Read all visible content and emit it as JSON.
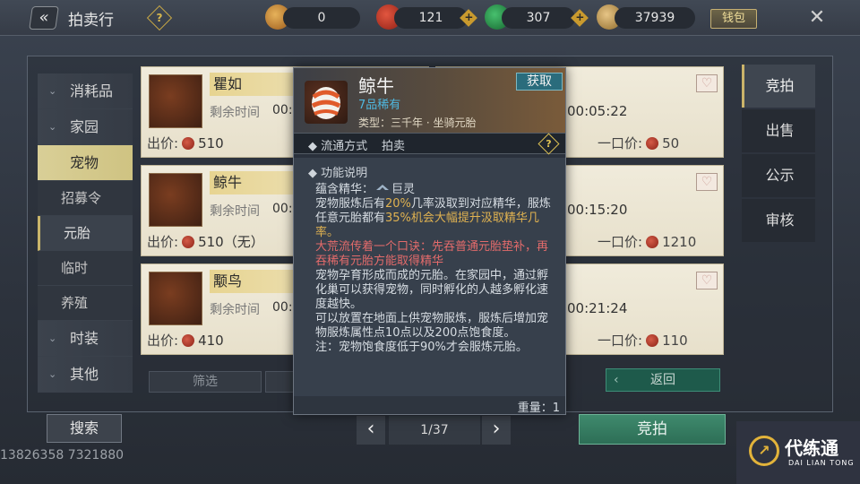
{
  "window": {
    "title": "拍卖行"
  },
  "currency": [
    {
      "name": "copper-coin",
      "value": "0",
      "color": "#d7943a"
    },
    {
      "name": "red-token",
      "value": "121",
      "color": "#c9412e"
    },
    {
      "name": "jade",
      "value": "307",
      "color": "#2f9a52"
    },
    {
      "name": "silver",
      "value": "37939",
      "color": "#c7a25b"
    }
  ],
  "top": {
    "wallet_label": "钱包",
    "help": "?"
  },
  "sidebar": {
    "items": [
      {
        "label": "消耗品"
      },
      {
        "label": "家园"
      },
      {
        "label": "宠物"
      },
      {
        "label": "时装"
      },
      {
        "label": "其他"
      }
    ],
    "subitems": [
      {
        "label": "招募令"
      },
      {
        "label": "元胎"
      },
      {
        "label": "临时"
      },
      {
        "label": "养殖"
      }
    ]
  },
  "listings_left": [
    {
      "name": "瞿如",
      "time_label": "剩余时间",
      "time_value": "00:0",
      "bid_label": "出价:",
      "bid": "510"
    },
    {
      "name": "鲸牛",
      "time_label": "剩余时间",
      "time_value": "00:0",
      "bid_label": "出价:",
      "bid": "510（无）"
    },
    {
      "name": "颙鸟",
      "time_label": "剩余时间",
      "time_value": "00:0",
      "bid_label": "出价:",
      "bid": "410"
    }
  ],
  "listings_right": [
    {
      "time": "00:05:22",
      "bo_label": "一口价:",
      "bo": "50"
    },
    {
      "time": "00:15:20",
      "bo_label": "一口价:",
      "bo": "1210"
    },
    {
      "time": "00:21:24",
      "bo_label": "一口价:",
      "bo": "110"
    }
  ],
  "controls": {
    "filter_label": "筛选",
    "return_label": "返回",
    "search_label": "搜索",
    "page": "1/37",
    "bid_label": "竞拍"
  },
  "right_tabs": [
    {
      "label": "竞拍"
    },
    {
      "label": "出售"
    },
    {
      "label": "公示"
    },
    {
      "label": "审核"
    }
  ],
  "tooltip": {
    "name": "鲸牛",
    "rarity": "7品稀有",
    "get_label": "获取",
    "type": "类型：三千年 · 坐骑元胎",
    "circ_key": "流通方式",
    "circ_val": "拍卖",
    "func_header": "功能说明",
    "essence_label": "蕴含精华：",
    "essence_value": "巨灵",
    "p1a": "宠物服炼后有",
    "p1b": "20%",
    "p1c": "几率汲取到对应精华，服炼任意元胎都有",
    "p1d": "35%机会大幅提升汲取精华几率。",
    "p2": "大荒流传着一个口诀：先吞普通元胎垫补，再吞稀有元胎方能取得精华",
    "p3": "宠物孕育形成而成的元胎。在家园中，通过孵化巢可以获得宠物，同时孵化的人越多孵化速度越快。",
    "p4": "可以放置在地面上供宠物服炼，服炼后增加宠物服炼属性点10点以及200点饱食度。",
    "p5": "注：宠物饱食度低于90%才会服炼元胎。",
    "weight": "重量：1"
  },
  "watermark": {
    "id": "13826358 7321880",
    "brand": "代练通",
    "brand_en": "DAI LIAN TONG"
  }
}
